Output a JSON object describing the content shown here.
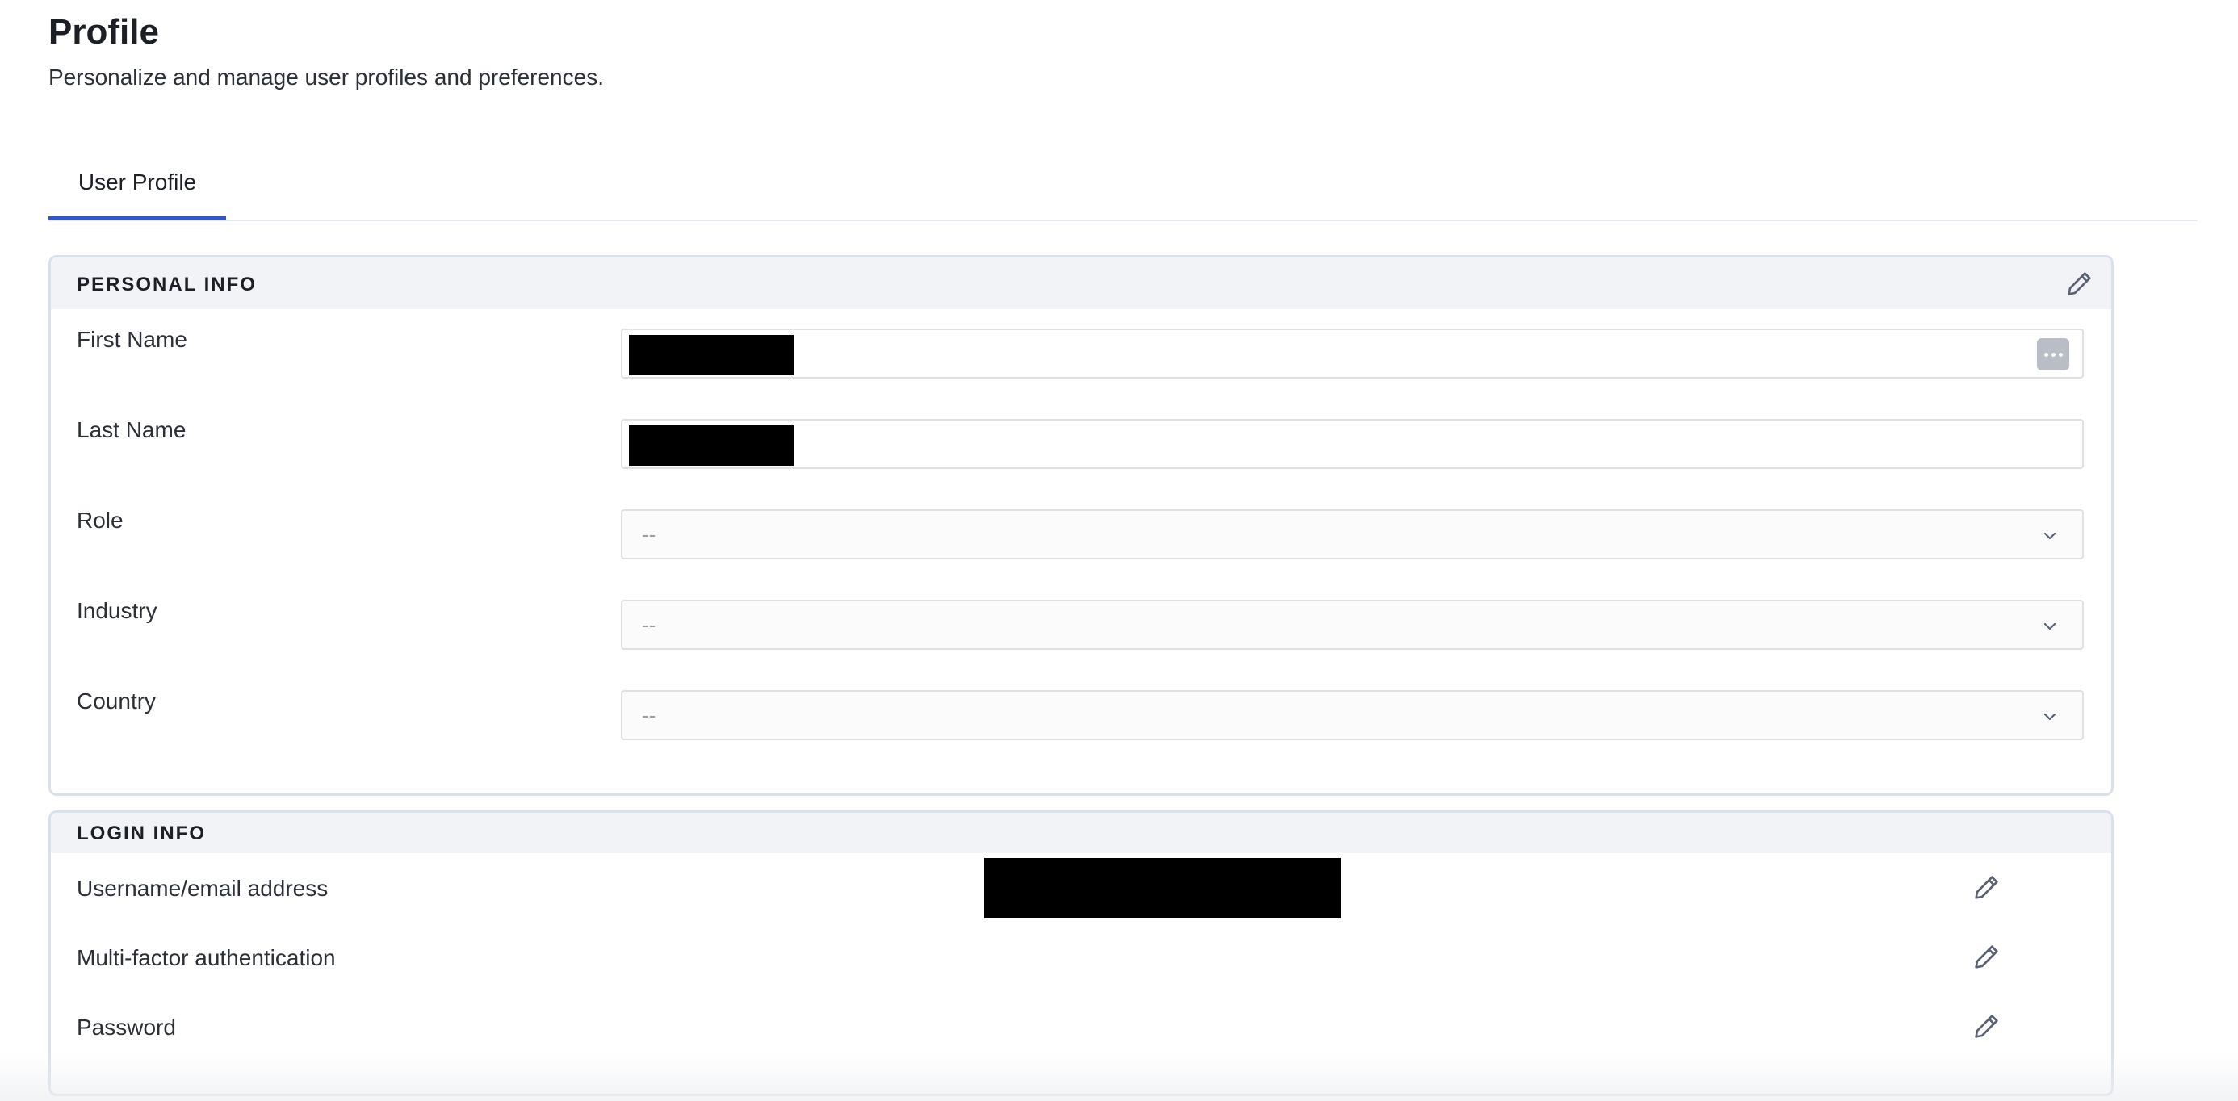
{
  "page": {
    "title": "Profile",
    "subtitle": "Personalize and manage user profiles and preferences."
  },
  "tabs": [
    {
      "label": "User Profile",
      "active": true
    }
  ],
  "personal_info": {
    "title": "PERSONAL INFO",
    "edit_icon": "pencil-icon",
    "fields": {
      "first_name": {
        "label": "First Name",
        "value": ""
      },
      "last_name": {
        "label": "Last Name",
        "value": ""
      },
      "role": {
        "label": "Role",
        "value": "--"
      },
      "industry": {
        "label": "Industry",
        "value": "--"
      },
      "country": {
        "label": "Country",
        "value": "--"
      }
    }
  },
  "login_info": {
    "title": "LOGIN INFO",
    "rows": {
      "username": {
        "label": "Username/email address",
        "value": ""
      },
      "mfa": {
        "label": "Multi-factor authentication"
      },
      "password": {
        "label": "Password"
      }
    }
  },
  "colors": {
    "accent": "#2f56d1",
    "header_bg": "#f1f3f7",
    "border": "#d9e1ea",
    "icon": "#5b6275"
  }
}
